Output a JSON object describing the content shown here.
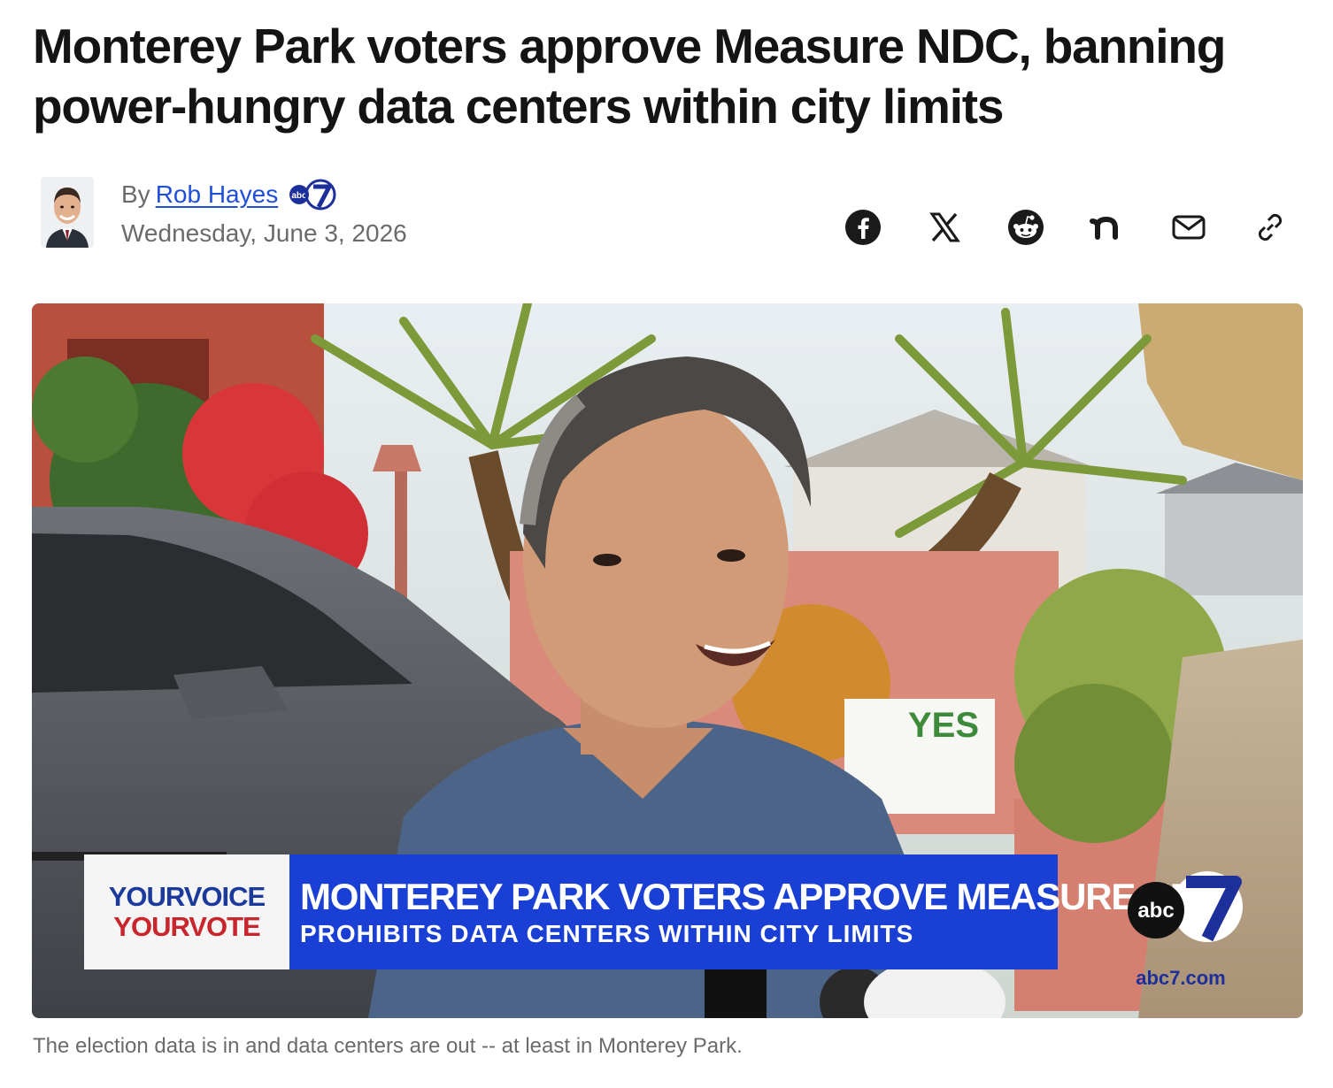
{
  "article": {
    "headline": "Monterey Park voters approve Measure NDC, banning power-hungry data centers within city limits",
    "byline": {
      "prefix": "By",
      "author": "Rob Hayes",
      "date": "Wednesday, June 3, 2026",
      "station_badge": "abc7-badge"
    },
    "share_icons": [
      "facebook-icon",
      "x-icon",
      "reddit-icon",
      "nextdoor-icon",
      "email-icon",
      "link-icon"
    ]
  },
  "hero": {
    "lower_third": {
      "brand_line_1": "YOURVOICE",
      "brand_line_2": "YOURVOTE",
      "headline": "MONTEREY PARK VOTERS APPROVE MEASURE NDC",
      "subhead": "PROHIBITS DATA CENTERS WITHIN CITY LIMITS"
    },
    "yard_sign_text": "YES",
    "logo": "abc",
    "url": "abc7.com",
    "caption": "The election data is in and data centers are out -- at least in Monterey Park."
  },
  "colors": {
    "link": "#1f4fd8",
    "chyron": "#1a3fd4",
    "brand_blue": "#1b3a9c",
    "brand_red": "#c8252c"
  }
}
